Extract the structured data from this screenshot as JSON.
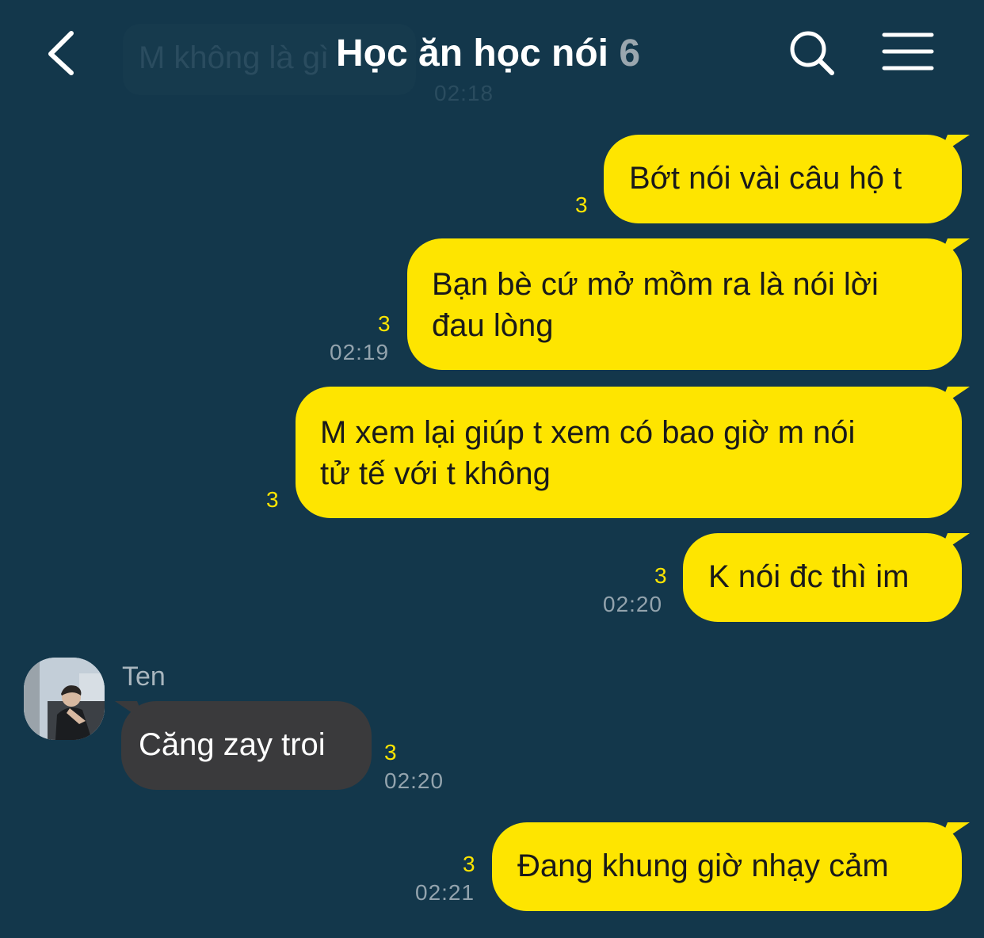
{
  "header": {
    "title": "Học ăn học nói",
    "member_count": "6",
    "back_icon": "chevron-left-icon",
    "search_icon": "search-icon",
    "menu_icon": "menu-icon"
  },
  "ghost_message": {
    "text": "M không là gì",
    "time": "02:18"
  },
  "messages": [
    {
      "direction": "out",
      "lines": [
        "Bớt nói vài câu hộ t"
      ],
      "unread": "3",
      "time": ""
    },
    {
      "direction": "out",
      "lines": [
        "Bạn bè cứ mở mồm ra là nói lời",
        "đau lòng"
      ],
      "unread": "3",
      "time": "02:19"
    },
    {
      "direction": "out",
      "lines": [
        "M xem lại giúp t xem có bao giờ m nói",
        "tử tế với t không"
      ],
      "unread": "3",
      "time": ""
    },
    {
      "direction": "out",
      "lines": [
        "K nói đc thì im"
      ],
      "unread": "3",
      "time": "02:20"
    },
    {
      "direction": "in",
      "sender": "Ten",
      "lines": [
        "Căng zay troi"
      ],
      "unread": "3",
      "time": "02:20"
    },
    {
      "direction": "out",
      "lines": [
        "Đang khung giờ nhạy cảm"
      ],
      "unread": "3",
      "time": "02:21"
    }
  ],
  "colors": {
    "background": "#13374b",
    "outgoing_bubble": "#fee500",
    "incoming_bubble": "#3a3a3c",
    "unread_count": "#fee500",
    "timestamp": "#93a3ad"
  }
}
